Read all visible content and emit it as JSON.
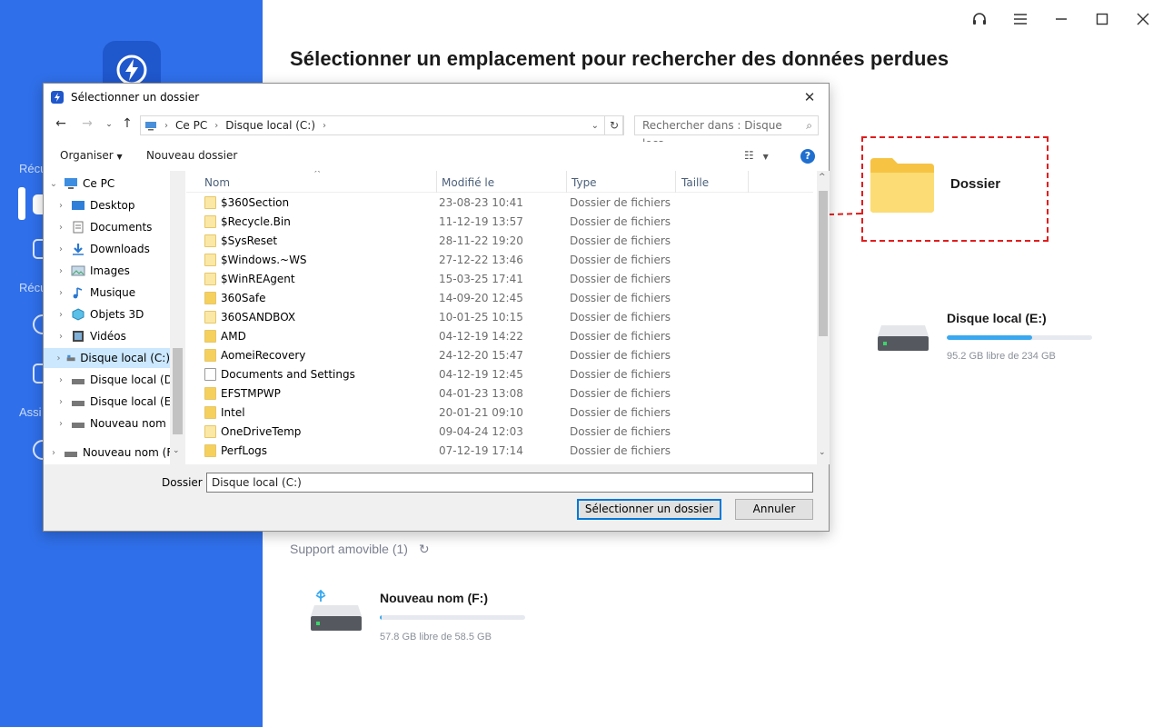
{
  "app": {
    "title": "Sélectionner un emplacement pour rechercher des données perdues",
    "sidebar": {
      "texts": [
        "Récu",
        "Récu",
        "Assi"
      ],
      "icons": [
        "scan-icon",
        "home-icon",
        "clock-icon",
        "monitor-icon",
        "help-icon"
      ]
    },
    "window_controls": [
      "headset-icon",
      "menu-icon",
      "minimize-icon",
      "maximize-icon",
      "close-icon"
    ],
    "dossier_label": "Dossier",
    "drive_e": {
      "name": "Disque local (E:)",
      "free": "95.2 GB libre de 234 GB",
      "used_fraction": 0.59
    },
    "support_title": "Support amovible (1)",
    "drive_f": {
      "name": "Nouveau nom (F:)",
      "free": "57.8 GB libre de 58.5 GB",
      "used_fraction": 0.01
    },
    "accent": "#2f6fe9",
    "annotation_color": "#e21c1c"
  },
  "dialog": {
    "title": "Sélectionner un dossier",
    "breadcrumb": [
      "Ce PC",
      "Disque local (C:)"
    ],
    "search_placeholder": "Rechercher dans : Disque loca...",
    "toolbar": {
      "organize": "Organiser",
      "new_folder": "Nouveau dossier"
    },
    "tree": [
      {
        "label": "Ce PC",
        "icon": "computer-icon"
      },
      {
        "label": "Desktop",
        "icon": "desktop-folder-icon"
      },
      {
        "label": "Documents",
        "icon": "documents-icon"
      },
      {
        "label": "Downloads",
        "icon": "downloads-icon"
      },
      {
        "label": "Images",
        "icon": "images-icon"
      },
      {
        "label": "Musique",
        "icon": "music-icon"
      },
      {
        "label": "Objets 3D",
        "icon": "3d-objects-icon"
      },
      {
        "label": "Vidéos",
        "icon": "videos-icon"
      },
      {
        "label": "Disque local (C:)",
        "icon": "drive-c-icon",
        "selected": true
      },
      {
        "label": "Disque local (D:)",
        "icon": "drive-icon"
      },
      {
        "label": "Disque local (E:)",
        "icon": "drive-icon"
      },
      {
        "label": "Nouveau nom (F",
        "icon": "drive-icon"
      },
      {
        "label": "Nouveau nom (F:)",
        "icon": "usb-drive-icon"
      }
    ],
    "columns": {
      "name": "Nom",
      "modified": "Modifié le",
      "type": "Type",
      "size": "Taille"
    },
    "files": [
      {
        "name": "$360Section",
        "date": "23-08-23 10:41",
        "type": "Dossier de fichiers"
      },
      {
        "name": "$Recycle.Bin",
        "date": "11-12-19 13:57",
        "type": "Dossier de fichiers"
      },
      {
        "name": "$SysReset",
        "date": "28-11-22 19:20",
        "type": "Dossier de fichiers"
      },
      {
        "name": "$Windows.~WS",
        "date": "27-12-22 13:46",
        "type": "Dossier de fichiers"
      },
      {
        "name": "$WinREAgent",
        "date": "15-03-25 17:41",
        "type": "Dossier de fichiers"
      },
      {
        "name": "360Safe",
        "date": "14-09-20 12:45",
        "type": "Dossier de fichiers"
      },
      {
        "name": "360SANDBOX",
        "date": "10-01-25 10:15",
        "type": "Dossier de fichiers"
      },
      {
        "name": "AMD",
        "date": "04-12-19 14:22",
        "type": "Dossier de fichiers"
      },
      {
        "name": "AomeiRecovery",
        "date": "24-12-20 15:47",
        "type": "Dossier de fichiers"
      },
      {
        "name": "Documents and Settings",
        "date": "04-12-19 12:45",
        "type": "Dossier de fichiers"
      },
      {
        "name": "EFSTMPWP",
        "date": "04-01-23 13:08",
        "type": "Dossier de fichiers"
      },
      {
        "name": "Intel",
        "date": "20-01-21 09:10",
        "type": "Dossier de fichiers"
      },
      {
        "name": "OneDriveTemp",
        "date": "09-04-24 12:03",
        "type": "Dossier de fichiers"
      },
      {
        "name": "PerfLogs",
        "date": "07-12-19 17:14",
        "type": "Dossier de fichiers"
      }
    ],
    "folder_label": "Dossier :",
    "folder_value": "Disque local (C:)",
    "select_button": "Sélectionner un dossier",
    "cancel_button": "Annuler"
  }
}
